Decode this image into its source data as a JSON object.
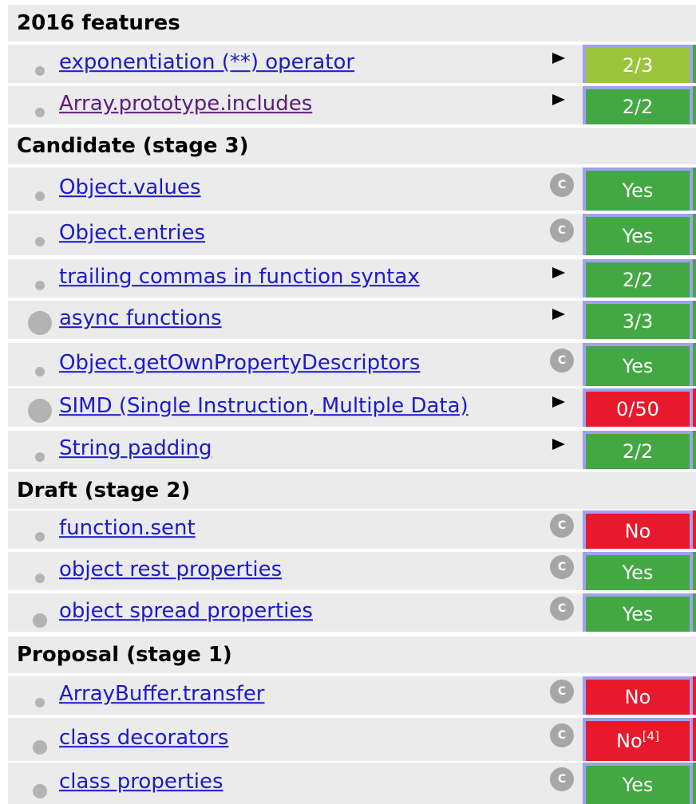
{
  "colors": {
    "yes": "#43a843",
    "no": "#e8192c",
    "partial": "#9bc43c",
    "link": "#1a1acc",
    "link_visited": "#5a1d7a",
    "cell_border": "#a0a0f0",
    "row_bg": "#ebebeb"
  },
  "sections": [
    {
      "title": "2016 features",
      "rows": [
        {
          "name": "exponentiation (**) operator",
          "control": "arrow",
          "result": "2/3",
          "status": "partial",
          "bullet": "small"
        },
        {
          "name": "Array.prototype.includes",
          "control": "arrow",
          "result": "2/2",
          "status": "yes",
          "bullet": "small",
          "visited": true
        }
      ]
    },
    {
      "title": "Candidate (stage 3)",
      "rows": [
        {
          "name": "Object.values",
          "control": "c",
          "result": "Yes",
          "status": "yes",
          "bullet": "small"
        },
        {
          "name": "Object.entries",
          "control": "c",
          "result": "Yes",
          "status": "yes",
          "bullet": "small"
        },
        {
          "name": "trailing commas in function syntax",
          "control": "arrow",
          "result": "2/2",
          "status": "yes",
          "bullet": "small"
        },
        {
          "name": "async functions",
          "control": "arrow",
          "result": "3/3",
          "status": "yes",
          "bullet": "big"
        },
        {
          "name": "Object.getOwnPropertyDescriptors",
          "control": "c",
          "result": "Yes",
          "status": "yes",
          "bullet": "small"
        },
        {
          "name": "SIMD (Single Instruction, Multiple Data)",
          "control": "arrow",
          "result": "0/50",
          "status": "no",
          "bullet": "big"
        },
        {
          "name": "String padding",
          "control": "arrow",
          "result": "2/2",
          "status": "yes",
          "bullet": "small"
        }
      ]
    },
    {
      "title": "Draft (stage 2)",
      "rows": [
        {
          "name": "function.sent",
          "control": "c",
          "result": "No",
          "status": "no",
          "bullet": "small"
        },
        {
          "name": "object rest properties",
          "control": "c",
          "result": "Yes",
          "status": "yes",
          "bullet": "small"
        },
        {
          "name": "object spread properties",
          "control": "c",
          "result": "Yes",
          "status": "yes",
          "bullet": "mid"
        }
      ]
    },
    {
      "title": "Proposal (stage 1)",
      "rows": [
        {
          "name": "ArrayBuffer.transfer",
          "control": "c",
          "result": "No",
          "status": "no",
          "bullet": "small"
        },
        {
          "name": "class decorators",
          "control": "c",
          "result": "No",
          "footnote": "[4]",
          "status": "no",
          "bullet": "mid"
        },
        {
          "name": "class properties",
          "control": "c",
          "result": "Yes",
          "status": "yes",
          "bullet": "mid"
        }
      ]
    }
  ],
  "icon_names": {
    "arrow": "expand-arrow-icon",
    "c": "c-info-icon"
  },
  "c_icon_glyph": "C"
}
